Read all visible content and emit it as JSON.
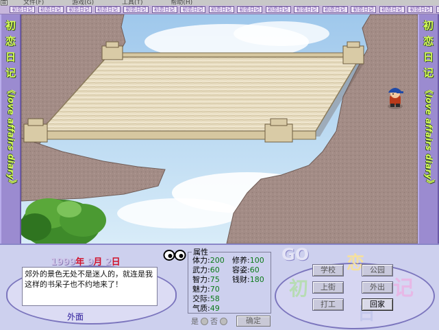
{
  "menubar": {
    "items": [
      "文件(F)",
      "游戏(G)",
      "工具(T)",
      "帮助(H)"
    ]
  },
  "ribbon": {
    "tile_text": "初恋日记",
    "tile_count": 17
  },
  "side_banner": {
    "title_chars": [
      "初",
      "恋",
      "日",
      "记"
    ],
    "subtitle": "《love affairs diary》"
  },
  "scene": {
    "description_icons": [
      "wooden-bridge",
      "rocky-cliff",
      "tree",
      "character-boy-blue-cap"
    ]
  },
  "status": {
    "year": "1999",
    "year_unit": "年",
    "month": "9",
    "month_unit": "月",
    "day": "2",
    "day_unit": "日",
    "message": "郊外的景色无处不是迷人的，就连是我这样的书呆子也不约地来了！",
    "location": "外面"
  },
  "attributes": {
    "title": "属性",
    "items": [
      {
        "label": "体力:",
        "value": "200"
      },
      {
        "label": "修养:",
        "value": "100"
      },
      {
        "label": "武力:",
        "value": "60"
      },
      {
        "label": "容姿:",
        "value": "60"
      },
      {
        "label": "智力:",
        "value": "75"
      },
      {
        "label": "钱财:",
        "value": "180"
      },
      {
        "label": "魅力:",
        "value": "70"
      },
      {
        "label": "交际:",
        "value": "58"
      },
      {
        "label": "气质:",
        "value": "49"
      }
    ]
  },
  "confirm": {
    "yes_label": "是",
    "no_label": "否",
    "confirm_label": "确定"
  },
  "actions": {
    "deco_go": "GO",
    "deco_chars": [
      "初",
      "恋",
      "日",
      "记"
    ],
    "buttons": [
      {
        "id": "school",
        "label": "学校"
      },
      {
        "id": "park",
        "label": "公园"
      },
      {
        "id": "street",
        "label": "上街"
      },
      {
        "id": "go-out",
        "label": "外出"
      },
      {
        "id": "work",
        "label": "打工"
      },
      {
        "id": "home",
        "label": "回家"
      }
    ]
  },
  "colors": {
    "accent": "#9b8bd0",
    "side_text": "#d8ff5a",
    "date_unit": "#d0102a",
    "attr_value": "#0a7a18",
    "location": "#2b1a9a"
  }
}
